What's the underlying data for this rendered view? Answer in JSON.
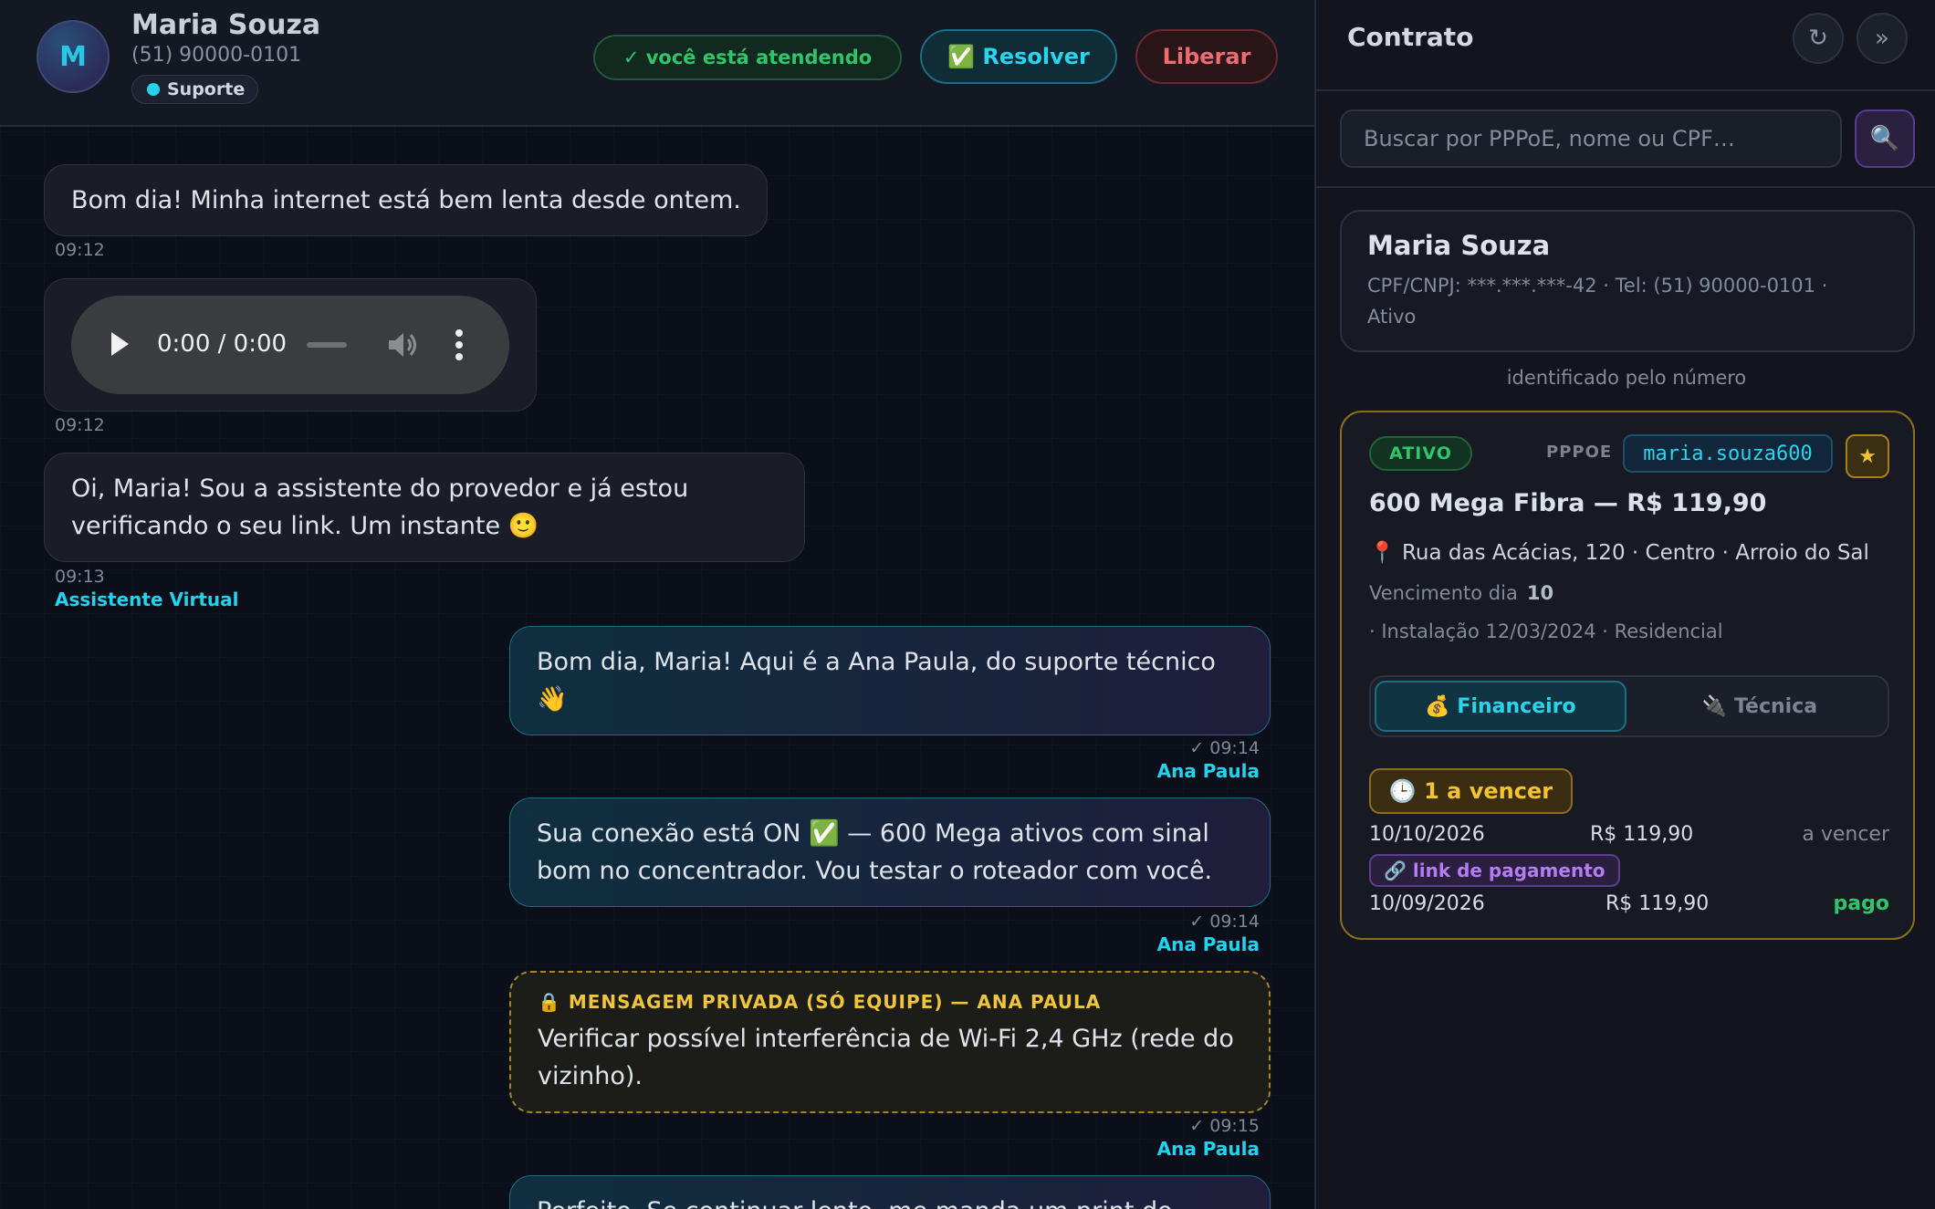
{
  "header": {
    "avatar_initial": "M",
    "contact_name": "Maria Souza",
    "contact_phone": "(51) 90000-0101",
    "department": "Suporte",
    "attending_label": "✓ você está atendendo",
    "resolve_label": "✅ Resolver",
    "release_label": "Liberar"
  },
  "messages": [
    {
      "direction": "in",
      "type": "text",
      "text": "Bom dia! Minha internet está bem lenta desde ontem.",
      "time": "09:12"
    },
    {
      "direction": "in",
      "type": "audio",
      "audio_time": "0:00 / 0:00",
      "time": "09:12"
    },
    {
      "direction": "in",
      "type": "text",
      "line1": "Oi, Maria! Sou a assistente do provedor e já estou",
      "line2": "verificando o seu link. Um instante 🙂",
      "time": "09:13",
      "author": "Assistente Virtual"
    },
    {
      "direction": "out",
      "type": "text",
      "line1": "Bom dia, Maria! Aqui é a Ana Paula, do suporte técnico",
      "line2": "👋",
      "time": "✓ 09:14",
      "author": "Ana Paula"
    },
    {
      "direction": "out",
      "type": "text",
      "line1": "Sua conexão está ON ✅ — 600 Mega ativos com sinal",
      "line2": "bom no concentrador. Vou testar o roteador com você.",
      "time": "✓ 09:14",
      "author": "Ana Paula"
    },
    {
      "direction": "out",
      "type": "private",
      "title": "🔒 MENSAGEM PRIVADA (SÓ EQUIPE) — ANA PAULA",
      "line1": "Verificar possível interferência de Wi-Fi 2,4 GHz (rede do",
      "line2": "vizinho).",
      "time": "✓ 09:15",
      "author": "Ana Paula"
    },
    {
      "direction": "out",
      "type": "text",
      "text": "Perfeito. Se continuar lento, me manda um print do"
    }
  ],
  "contract_panel": {
    "title": "Contrato",
    "refresh_icon": "↻",
    "collapse_icon": "»",
    "search_placeholder": "Buscar por PPPoE, nome ou CPF…",
    "search_icon": "🔍",
    "client": {
      "name": "Maria Souza",
      "info_line1": "CPF/CNPJ: ***.***.***-42 · Tel: (51) 90000-0101 ·",
      "info_line2": "Ativo"
    },
    "identified_note": "identificado pelo número",
    "contract": {
      "status": "ATIVO",
      "pppoe_label": "PPPOE",
      "pppoe_value": "maria.souza600",
      "star_icon": "★",
      "plan": "600 Mega Fibra — R$ 119,90",
      "address": "📍 Rua das Acácias, 120 · Centro · Arroio do Sal",
      "due_label": "Vencimento dia",
      "due_day": "10",
      "install_line": "· Instalação 12/03/2024 · Residencial",
      "tabs": [
        {
          "label": "💰 Financeiro",
          "active": true
        },
        {
          "label": "🔌 Técnica",
          "active": false
        }
      ],
      "due_badge": "🕒 1 a vencer",
      "invoices": [
        {
          "date": "10/10/2026",
          "amount": "R$ 119,90",
          "status": "a vencer",
          "status_color": "#838a99"
        },
        {
          "date": "10/09/2026",
          "amount": "R$ 119,90",
          "status": "pago",
          "status_color": "#2fc56a"
        }
      ],
      "payment_link_label": "🔗 link de pagamento"
    }
  }
}
